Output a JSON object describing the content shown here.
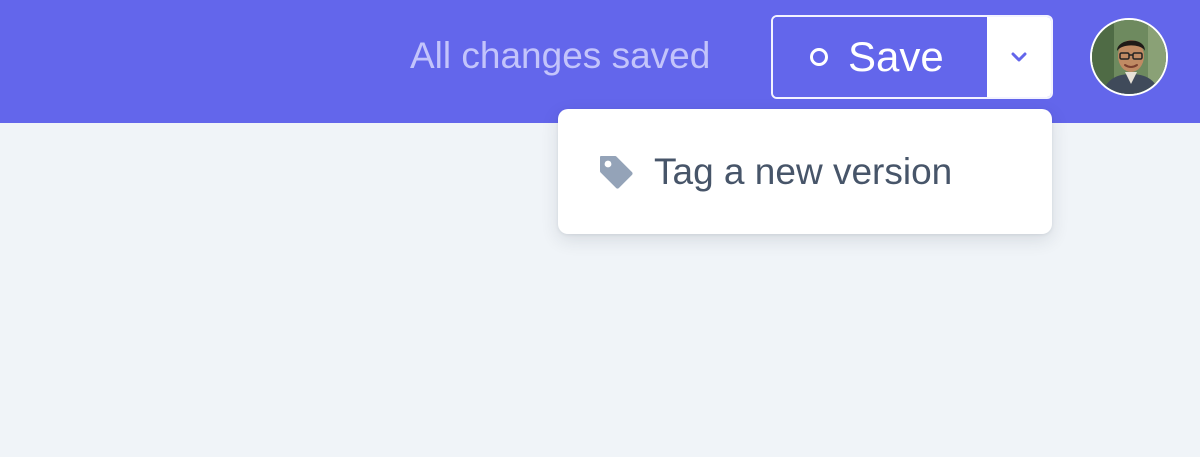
{
  "header": {
    "status_text": "All changes saved",
    "save_label": "Save",
    "save_status_icon": "circle-icon",
    "dropdown_icon": "chevron-down-icon",
    "avatar_icon": "user-avatar"
  },
  "menu": {
    "items": [
      {
        "label": "Tag a new version",
        "icon": "tag-icon"
      }
    ]
  },
  "colors": {
    "accent": "#6366eb",
    "status_text": "#c3c4fb",
    "background": "#f0f4f8",
    "menu_text": "#475569",
    "tag_icon": "#94a3b8"
  }
}
